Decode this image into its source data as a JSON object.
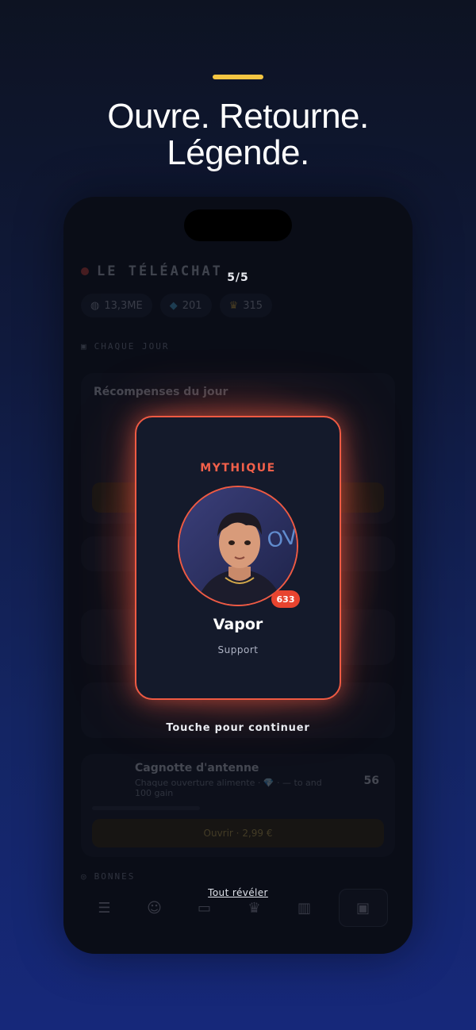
{
  "headline": {
    "line1": "Ouvre. Retourne.",
    "line2": "Légende."
  },
  "colors": {
    "accent": "#f4c542",
    "mythic": "#ee5a43",
    "background_top": "#0d1322",
    "background_bottom": "#16287a"
  },
  "background_app": {
    "title": "LE TÉLÉACHAT",
    "stats": [
      {
        "icon": "coins-icon",
        "value": "13,3ME"
      },
      {
        "icon": "diamond-icon",
        "value": "201"
      },
      {
        "icon": "trophy-icon",
        "value": "315"
      }
    ],
    "daily_section_label": "CHAQUE JOUR",
    "daily_card_title": "Récompenses du jour",
    "bonus_section_label": "BONNES",
    "pot_card": {
      "title": "Cagnotte d'antenne",
      "subtitle": "Chaque ouverture alimente · 💎 · — to and 100 gain",
      "gems": "56",
      "button_label": "Ouvrir · 2,99 €"
    },
    "nav_icons": [
      "list-icon",
      "people-icon",
      "cards-icon",
      "trophy-icon",
      "chart-icon",
      "pack-icon"
    ]
  },
  "reveal": {
    "counter": "5/5",
    "rarity": "MYTHIQUE",
    "level": "633",
    "name": "Vapor",
    "role": "Support",
    "continue_hint": "Touche pour continuer",
    "reveal_all": "Tout révéler"
  }
}
